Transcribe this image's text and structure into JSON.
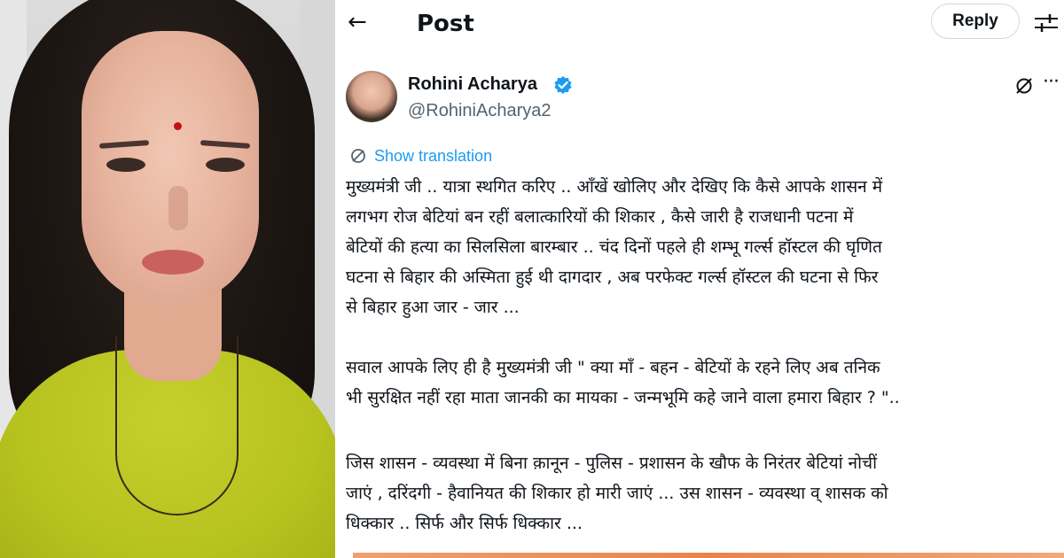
{
  "header": {
    "title": "Post",
    "reply_label": "Reply"
  },
  "author": {
    "name": "Rohini Acharya",
    "handle": "@RohiniAcharya2"
  },
  "show_translation_label": "Show translation",
  "body": {
    "paragraphs": [
      [
        "मुख्यमंत्री जी .. यात्रा स्थगित करिए .. आँखें खोलिए और देखिए कि कैसे आपके शासन में",
        "लगभग रोज बेटियां बन रहीं बलात्कारियों की शिकार , कैसे जारी है राजधानी पटना में",
        "बेटियों की हत्या का सिलसिला बारम्बार .. चंद दिनों पहले ही शम्भू गर्ल्स हॉस्टल की घृणित",
        "घटना से बिहार की अस्मिता हुई थी दागदार , अब परफेक्ट गर्ल्स हॉस्टल की घटना से फिर",
        "से बिहार हुआ जार - जार ..."
      ],
      [
        "सवाल आपके लिए ही है मुख्यमंत्री जी \" क्या माँ - बहन - बेटियों के रहने लिए अब तनिक",
        "भी सुरक्षित नहीं रहा माता जानकी का मायका - जन्मभूमि कहे जाने वाला हमारा बिहार ? \".."
      ],
      [
        "जिस शासन - व्यवस्था में बिना क़ानून - पुलिस - प्रशासन के खौफ के निरंतर बेटियां नोचीं",
        "जाएं , दरिंदगी - हैवानियत की शिकार हो मारी जाएं ... उस शासन - व्यवस्था व् शासक को",
        "धिक्कार .. सिर्फ और सिर्फ धिक्कार ..."
      ]
    ]
  },
  "colors": {
    "accent": "#1d9bf0",
    "text": "#0f1419",
    "muted": "#536471",
    "border": "#cfd9de"
  },
  "icons": [
    "back-arrow-icon",
    "settings-icon",
    "verified-badge-icon",
    "grok-icon",
    "more-icon",
    "translate-icon"
  ]
}
